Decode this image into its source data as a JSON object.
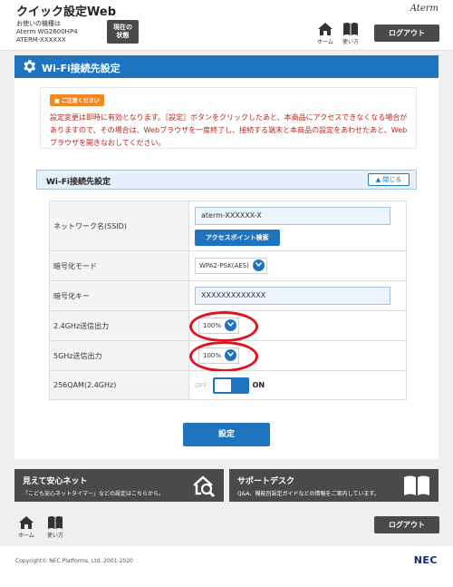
{
  "header": {
    "title": "クイック設定Web",
    "device_caption": "お使いの機種は",
    "device_model": "Aterm WG2600HP4",
    "device_id": "ATERM-XXXXXX",
    "status_label_1": "現在の",
    "status_label_2": "状態",
    "logo": "Aterm",
    "home_label": "ホーム",
    "help_label": "使い方",
    "logout_label": "ログアウト"
  },
  "page_title": "Wi-Fi接続先設定",
  "notice": {
    "badge": "ご注意ください",
    "text": "設定変更は即時に有効となります。［設定］ボタンをクリックしたあと、本商品にアクセスできなくなる場合がありますので、その場合は、Webブラウザを一度終了し、接続する端末と本商品の設定をあわせたあと、Webブラウザを開きなおしてください。"
  },
  "section": {
    "title": "Wi-Fi接続先設定",
    "close_label": "閉じる"
  },
  "form": {
    "ssid_label": "ネットワーク名(SSID)",
    "ssid_value": "aterm-XXXXXX-X",
    "scan_button": "アクセスポイント検索",
    "encryption_label": "暗号化モード",
    "encryption_value": "WPA2-PSK(AES)",
    "key_label": "暗号化キー",
    "key_value": "XXXXXXXXXXXXX",
    "power24_label": "2.4GHz送信出力",
    "power24_value": "100%",
    "power5_label": "5GHz送信出力",
    "power5_value": "100%",
    "qam_label": "256QAM(2.4GHz)",
    "qam_off": "OFF",
    "qam_on": "ON",
    "submit_label": "設定"
  },
  "promos": {
    "left_title": "見えて安心ネット",
    "left_sub": "「こども安心ネットタイマー」などの設定はこちらから。",
    "right_title": "サポートデスク",
    "right_sub": "Q&A、機能別設定ガイドなどの情報をご案内しています。"
  },
  "footer": {
    "home_label": "ホーム",
    "help_label": "使い方",
    "logout_label": "ログアウト",
    "copyright": "Copyright© NEC Platforms, Ltd. 2001-2020",
    "nec_logo": "NEC"
  },
  "colors": {
    "primary": "#1f74c0",
    "dark": "#4a4a4a",
    "alert": "#b3261e",
    "badge": "#f08a20",
    "highlight": "#e0141e"
  }
}
